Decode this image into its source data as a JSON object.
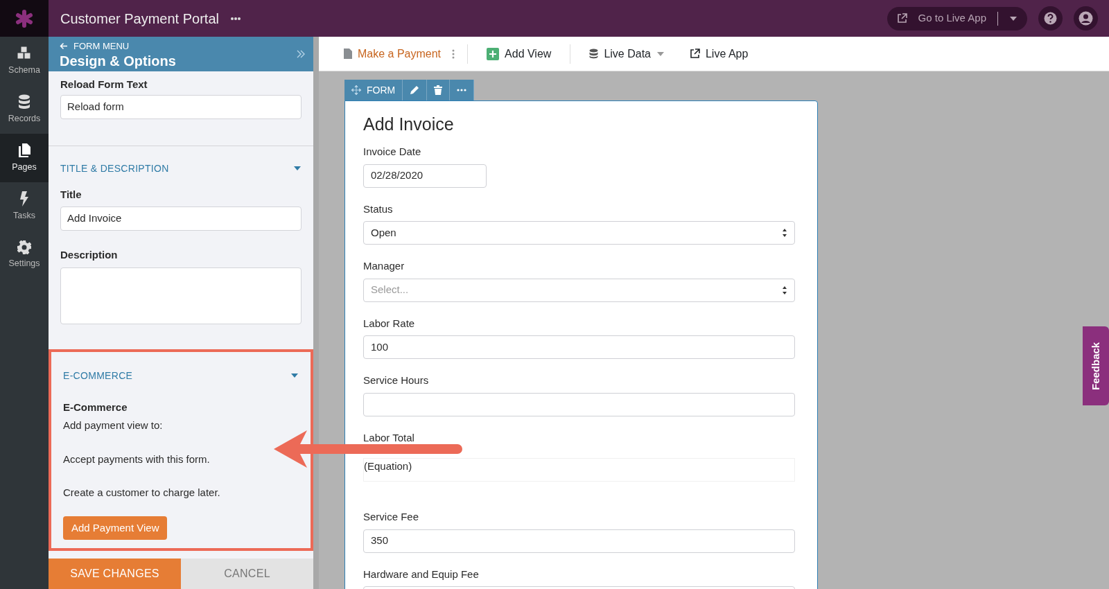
{
  "app": {
    "title": "Customer Payment Portal",
    "go_live_button": "Go to Live App"
  },
  "rail": [
    {
      "label": "Schema",
      "selected": false
    },
    {
      "label": "Records",
      "selected": false
    },
    {
      "label": "Pages",
      "selected": true
    },
    {
      "label": "Tasks",
      "selected": false
    },
    {
      "label": "Settings",
      "selected": false
    }
  ],
  "panel": {
    "back_link": "FORM MENU",
    "title": "Design & Options",
    "reload_label": "Reload Form Text",
    "reload_value": "Reload form",
    "title_section": {
      "heading": "TITLE & DESCRIPTION",
      "expanded": true,
      "title_label": "Title",
      "title_value": "Add Invoice",
      "description_label": "Description"
    },
    "ecommerce": {
      "heading": "E-COMMERCE",
      "expanded": true,
      "highlighted": true,
      "subheading": "E-Commerce",
      "lines": [
        "Add payment view to:",
        "Accept payments with this form.",
        "Create a customer to charge later."
      ],
      "button": "Add Payment View"
    },
    "actions": {
      "save": "SAVE CHANGES",
      "cancel": "CANCEL"
    }
  },
  "toolbar": {
    "page": "Make a Payment",
    "add_view": "Add View",
    "live_data": "Live Data",
    "live_app": "Live App"
  },
  "form": {
    "toolbar_label": "FORM",
    "title": "Add Invoice",
    "fields": [
      {
        "label": "Invoice Date",
        "kind": "date",
        "value": "02/28/2020"
      },
      {
        "label": "Status",
        "kind": "select",
        "value": "Open"
      },
      {
        "label": "Manager",
        "kind": "select",
        "placeholder": "Select..."
      },
      {
        "label": "Labor Rate",
        "kind": "text",
        "value": "100"
      },
      {
        "label": "Service Hours",
        "kind": "text"
      },
      {
        "label": "Labor Total",
        "kind": "equation",
        "value": "(Equation)"
      },
      {
        "label": "Service Fee",
        "kind": "text",
        "value": "350"
      },
      {
        "label": "Hardware and Equip Fee",
        "kind": "text"
      }
    ]
  },
  "feedback": "Feedback"
}
